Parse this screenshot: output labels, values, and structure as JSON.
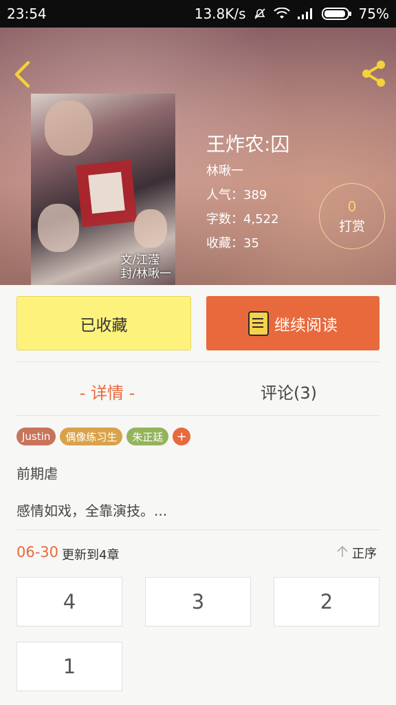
{
  "status_bar": {
    "time": "23:54",
    "net_speed": "13.8K/s",
    "battery": "75%"
  },
  "header": {
    "title": "王炸农:囚",
    "author": "林啾一",
    "popularity": "人气：389",
    "word_count": "字数：4,522",
    "favorites": "收藏：35",
    "reward_count": "0",
    "reward_label": "打赏",
    "cover_text_line1": "文/江滢",
    "cover_text_line2": "封/林啾一"
  },
  "actions": {
    "favorited_label": "已收藏",
    "continue_label": "继续阅读"
  },
  "tabs": [
    {
      "label": "- 详情 -"
    },
    {
      "label": "评论(3)"
    }
  ],
  "tags": [
    {
      "label": "Justin",
      "color": "#c8745a"
    },
    {
      "label": "偶像练习生",
      "color": "#d9a24a"
    },
    {
      "label": "朱正廷",
      "color": "#93b45a"
    }
  ],
  "tag_add_label": "+",
  "description": {
    "line1": "前期虐",
    "line2": "感情如戏，全靠演技。..."
  },
  "chapters": {
    "update_date": "06-30",
    "update_text": "更新到4章",
    "sort_label": "正序",
    "items": [
      "4",
      "3",
      "2",
      "1"
    ]
  },
  "colors": {
    "accent": "#e8693c",
    "fav_button": "#fdf27c",
    "reward_number": "#f6d56d"
  }
}
